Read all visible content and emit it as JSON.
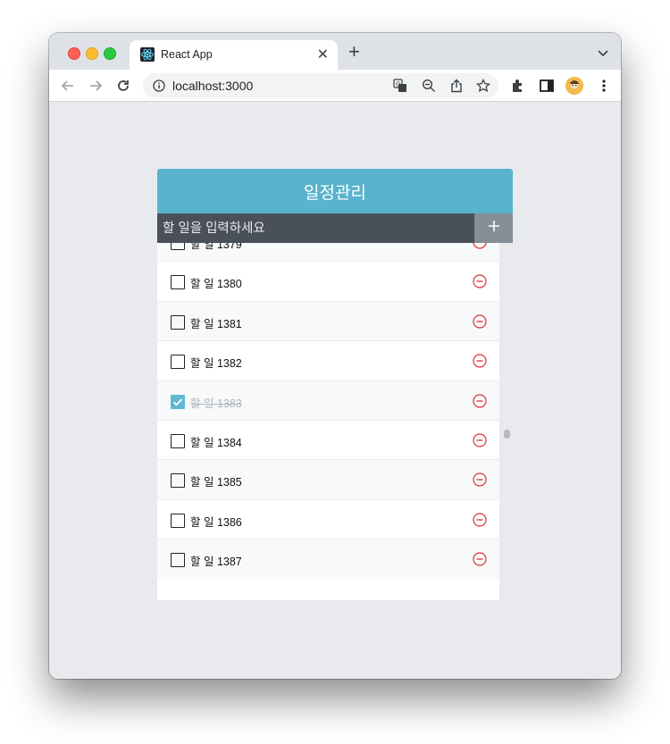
{
  "browser": {
    "tab_title": "React App",
    "url": "localhost:3000"
  },
  "app": {
    "title": "일정관리",
    "input_placeholder": "할 일을 입력하세요",
    "todos": [
      {
        "text": "할 일 1379",
        "checked": false
      },
      {
        "text": "할 일 1380",
        "checked": false
      },
      {
        "text": "할 일 1381",
        "checked": false
      },
      {
        "text": "할 일 1382",
        "checked": false
      },
      {
        "text": "할 일 1383",
        "checked": true
      },
      {
        "text": "할 일 1384",
        "checked": false
      },
      {
        "text": "할 일 1385",
        "checked": false
      },
      {
        "text": "할 일 1386",
        "checked": false
      },
      {
        "text": "할 일 1387",
        "checked": false
      }
    ]
  },
  "colors": {
    "header": "#59b3cd",
    "insert_bg": "#495057",
    "add_button": "#868e96",
    "checked": "#5fb8d3",
    "remove": "#e03131"
  },
  "icons": [
    "react-icon",
    "close-icon",
    "plus-icon",
    "back-icon",
    "forward-icon",
    "reload-icon",
    "info-icon",
    "translate-icon",
    "zoom-icon",
    "share-icon",
    "star-icon",
    "extensions-icon",
    "side-panel-icon",
    "profile-avatar",
    "kebab-menu-icon",
    "checkbox-icon",
    "remove-icon"
  ]
}
